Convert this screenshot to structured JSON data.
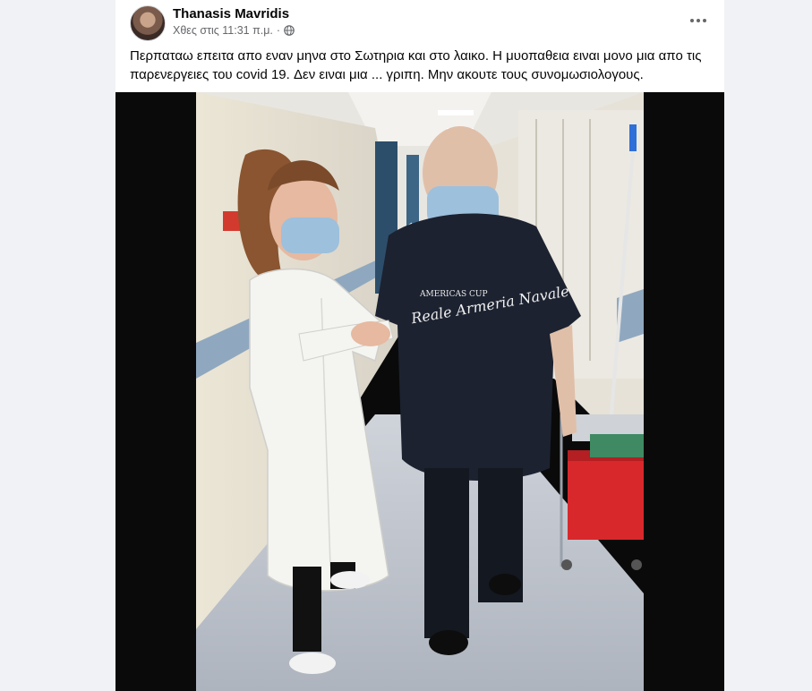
{
  "post": {
    "author": "Thanasis Mavridis",
    "timestamp": "Χθες στις 11:31 π.μ.",
    "separator": "·",
    "privacy_icon": "globe-icon",
    "more_icon": "more-horizontal-icon",
    "text": "Περπαταω επειτα απο εναν μηνα στο Σωτηρια και στο λαικο. Η μυοπαθεια ειναι μονο μια απο τις παρενεργειες του covid 19. Δεν ειναι μια ... γριπη. Μην ακουτε τους συνομωσιολογους."
  },
  "photo": {
    "shirt_print_line1": "AMERICAS CUP",
    "shirt_print_line2": "Reale Armeria Navale",
    "colors": {
      "background": "#0a0a0a",
      "wall": "#e9e4d8",
      "floor": "#bfc4cc",
      "coat": "#f4f4f1",
      "shirt": "#1c2230",
      "bucket": "#d8282c",
      "mask": "#9dc0dc"
    }
  },
  "colors": {
    "page_background": "#f0f2f5",
    "card_background": "#ffffff",
    "primary_text": "#050505",
    "secondary_text": "#65676b"
  }
}
